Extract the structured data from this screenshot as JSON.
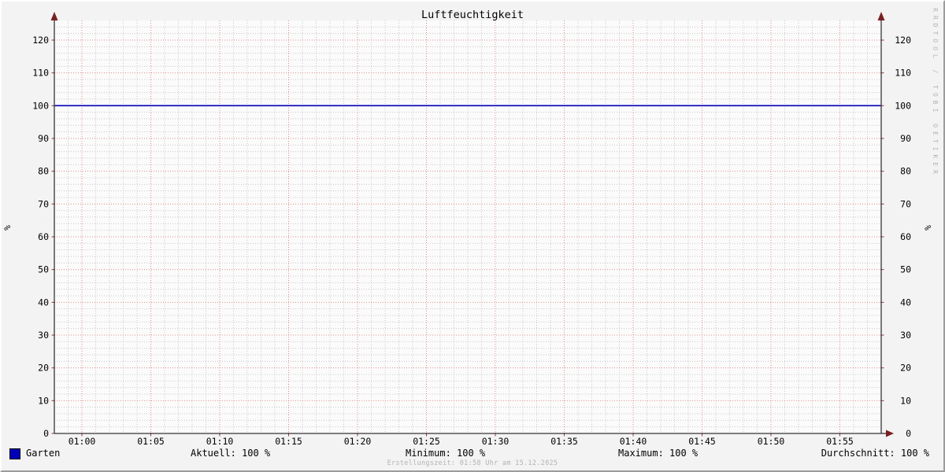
{
  "title": "Luftfeuchtigkeit",
  "watermark": "RRDTOOL / TOBI OETIKER",
  "footer": {
    "creation_text": "Erstellungszeit: 01:58 Uhr am 15.12.2025"
  },
  "legend": {
    "series_label": "Garten",
    "stats": [
      {
        "label": "Aktuell",
        "value": "100 %",
        "text": "Aktuell: 100 %"
      },
      {
        "label": "Minimum",
        "value": "100 %",
        "text": "Minimum: 100 %"
      },
      {
        "label": "Maximum",
        "value": "100 %",
        "text": "Maximum: 100 %"
      },
      {
        "label": "Durchschnitt",
        "value": "100 %",
        "text": "Durchschnitt: 100 %"
      }
    ]
  },
  "chart_data": {
    "type": "line",
    "title": "Luftfeuchtigkeit",
    "xlabel": "",
    "ylabel": "%",
    "x_tick_labels": [
      "01:00",
      "01:05",
      "01:10",
      "01:15",
      "01:20",
      "01:25",
      "01:30",
      "01:35",
      "01:40",
      "01:45",
      "01:50",
      "01:55"
    ],
    "x_first_tick_min": 2,
    "x_major_every_min": 5,
    "x_minor_every_min": 1,
    "x_total_minutes": 60,
    "y_ticks": [
      0,
      10,
      20,
      30,
      40,
      50,
      60,
      70,
      80,
      90,
      100,
      110,
      120
    ],
    "y_minor_step": 2,
    "ylim": [
      0,
      126
    ],
    "grid": true,
    "legend_position": "bottom",
    "series": [
      {
        "name": "Garten",
        "color": "#0000bb",
        "style": "constant-line",
        "value": 100,
        "unit": "%"
      }
    ],
    "stats": {
      "aktuell": 100,
      "minimum": 100,
      "maximum": 100,
      "durchschnitt": 100,
      "unit": "%"
    }
  },
  "colors": {
    "background": "#f3f3f3",
    "canvas": "#fbfbfb",
    "major_grid": "#d75c5c",
    "minor_grid": "#8b8b8b",
    "axis": "#363636",
    "arrow": "#7a1f1f",
    "tick": "#a03232",
    "series": "#0000bb",
    "watermark_text": "#b4b4b4"
  }
}
